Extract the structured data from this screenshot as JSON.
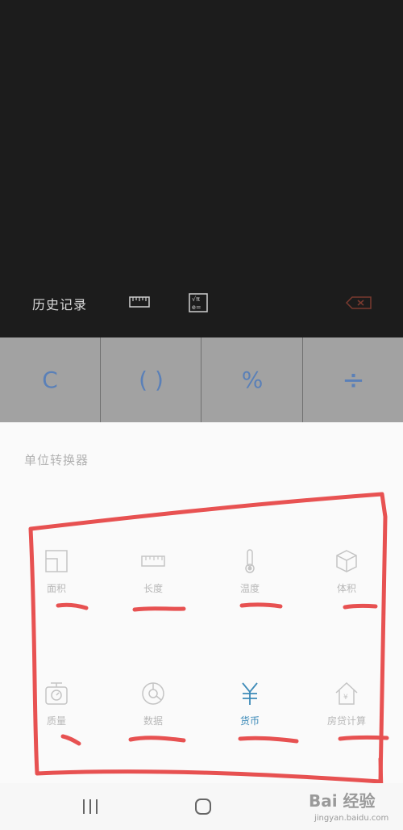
{
  "display": {
    "history_label": "历史记录",
    "icons": [
      "ruler-icon",
      "scientific-icon",
      "backspace-icon"
    ]
  },
  "keys": [
    {
      "label": "C"
    },
    {
      "label": "( )"
    },
    {
      "label": "%"
    },
    {
      "label": "÷"
    }
  ],
  "converter": {
    "title": "单位转换器",
    "items": [
      {
        "label": "面积",
        "icon": "area-icon",
        "active": false
      },
      {
        "label": "长度",
        "icon": "ruler-icon",
        "active": false
      },
      {
        "label": "温度",
        "icon": "thermometer-icon",
        "active": false
      },
      {
        "label": "体积",
        "icon": "cube-icon",
        "active": false
      },
      {
        "label": "质量",
        "icon": "scale-icon",
        "active": false
      },
      {
        "label": "数据",
        "icon": "data-icon",
        "active": false
      },
      {
        "label": "货币",
        "icon": "yen-icon",
        "active": true
      },
      {
        "label": "房贷计算",
        "icon": "house-loan-icon",
        "active": false
      }
    ]
  },
  "colors": {
    "display_bg": "#1c1c1c",
    "key_bg": "#a2a2a2",
    "key_text": "#5a80b8",
    "active_item": "#3c8ab8",
    "annotation": "#e53a3a"
  },
  "navbar": {
    "icons": [
      "recent-apps-icon",
      "home-icon"
    ],
    "watermark": "Bai 经验",
    "watermark_sub": "jingyan.baidu.com"
  }
}
